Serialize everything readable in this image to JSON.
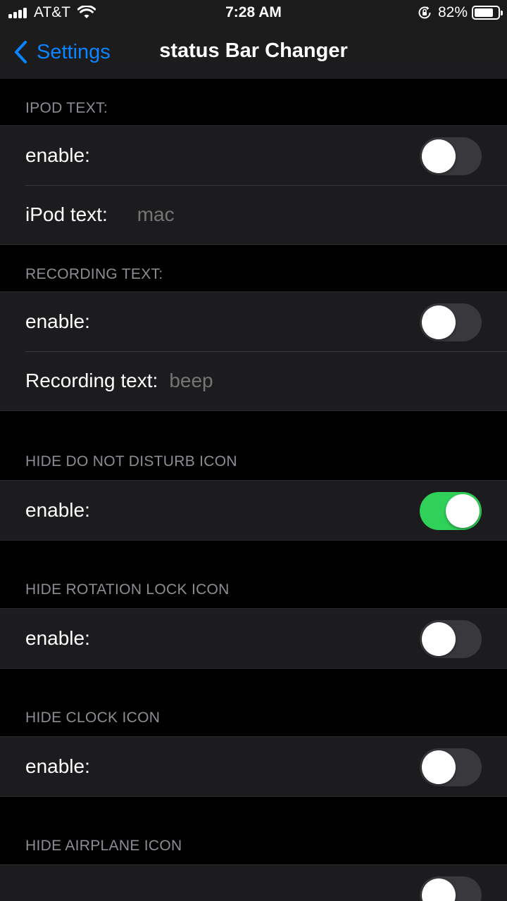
{
  "status_bar": {
    "carrier": "AT&T",
    "time": "7:28 AM",
    "battery_percent": "82%",
    "battery_level": 0.82,
    "icons": [
      "signal-icon",
      "wifi-icon",
      "rotation-lock-icon",
      "battery-icon"
    ]
  },
  "nav": {
    "back_label": "Settings",
    "title": "status Bar Changer"
  },
  "colors": {
    "accent": "#0a84ff",
    "toggle_on": "#30d158",
    "toggle_off": "#39393d",
    "background": "#000000",
    "cell": "#1c1c1e"
  },
  "sections": {
    "ipod": {
      "header": "IPOD TEXT:",
      "enable_label": "enable:",
      "enable_on": false,
      "text_label": "iPod text:",
      "text_placeholder": "mac"
    },
    "recording": {
      "header": "RECORDING TEXT:",
      "enable_label": "enable:",
      "enable_on": false,
      "text_label": "Recording text:",
      "text_placeholder": "beep"
    },
    "dnd": {
      "header": "HIDE DO NOT DISTURB ICON",
      "enable_label": "enable:",
      "enable_on": true
    },
    "rotation": {
      "header": "HIDE ROTATION LOCK ICON",
      "enable_label": "enable:",
      "enable_on": false
    },
    "clock": {
      "header": "HIDE CLOCK ICON",
      "enable_label": "enable:",
      "enable_on": false
    },
    "airplane": {
      "header": "HIDE AIRPLANE ICON",
      "enable_on": false
    }
  }
}
